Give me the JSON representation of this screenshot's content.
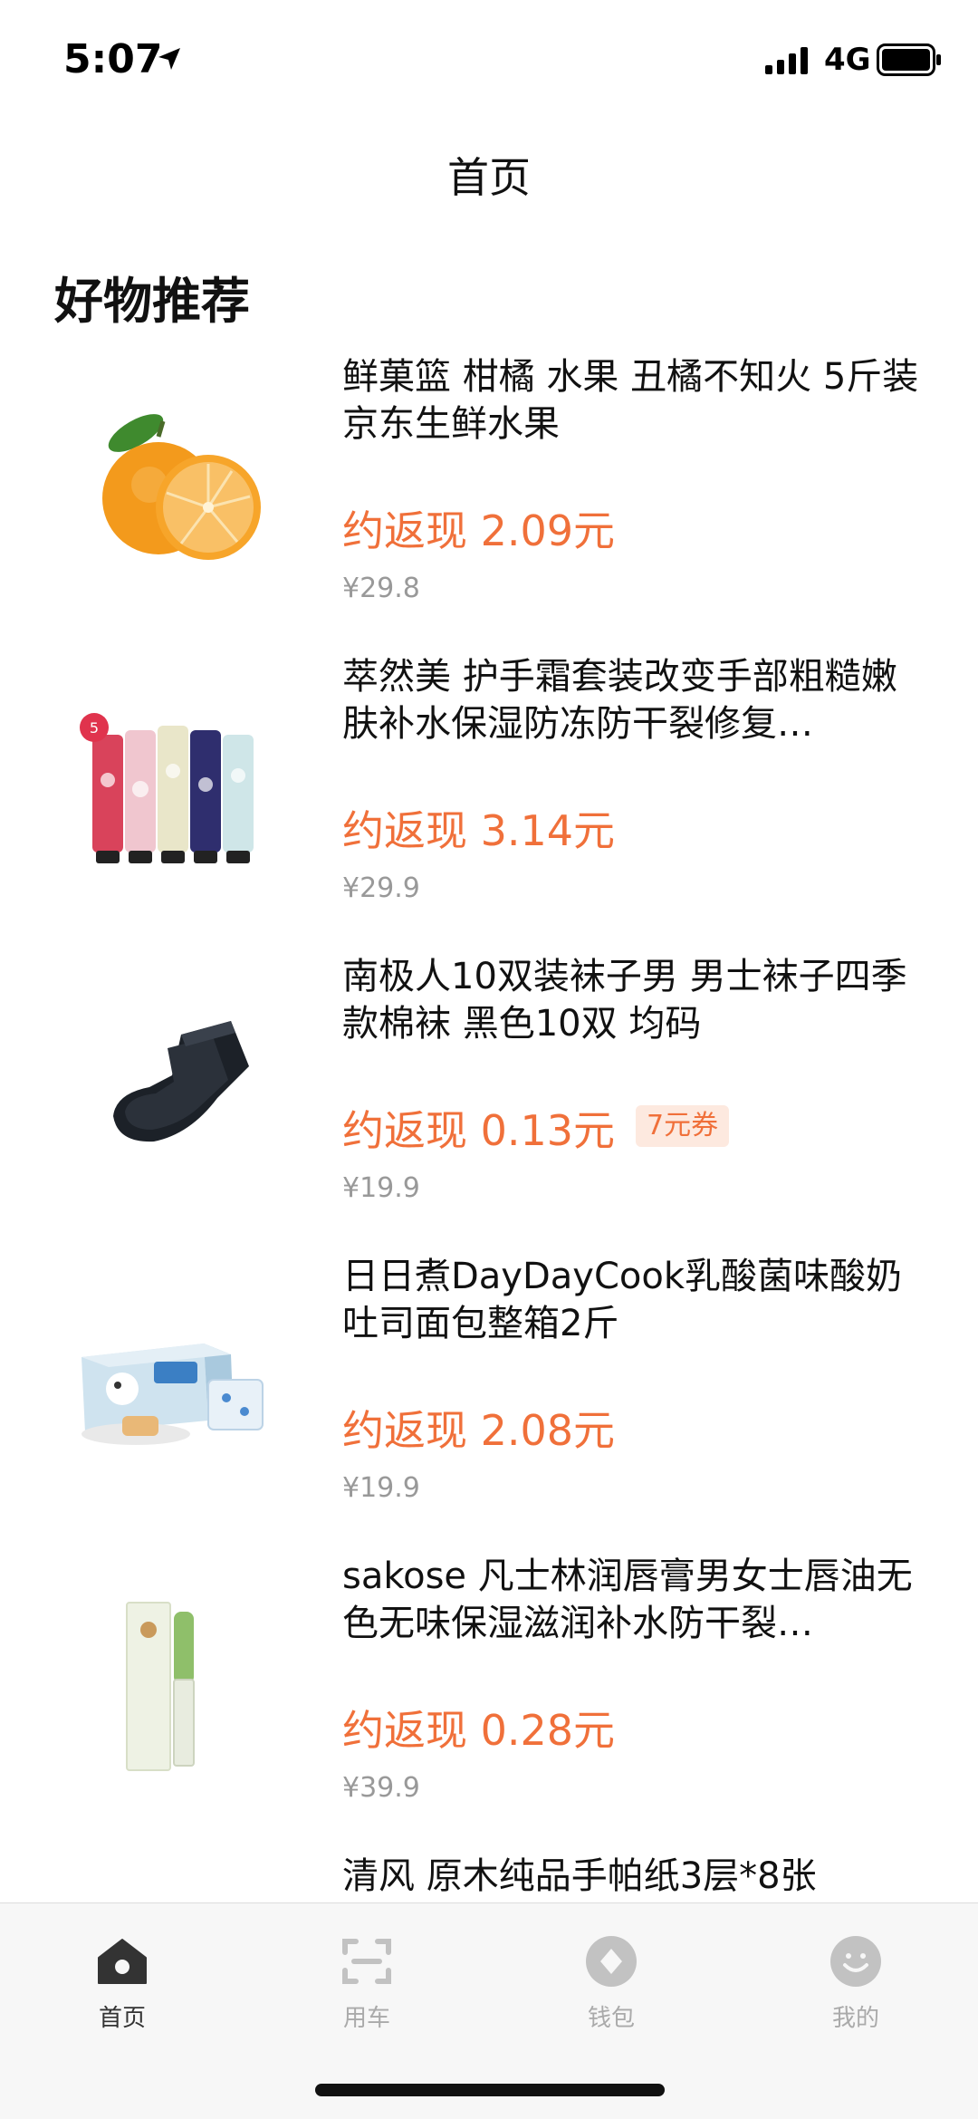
{
  "status": {
    "time": "5:07",
    "network": "4G"
  },
  "nav": {
    "title": "首页"
  },
  "section": {
    "title": "好物推荐"
  },
  "products": [
    {
      "title": "鲜菓篮 柑橘 水果 丑橘不知火 5斤装 京东生鲜水果",
      "cashback": "约返现 2.09元",
      "price": "¥29.8",
      "image": "orange-image"
    },
    {
      "title": "萃然美 护手霜套装改变手部粗糙嫩肤补水保湿防冻防干裂修复…",
      "cashback": "约返现 3.14元",
      "price": "¥29.9",
      "image": "hand-cream-image"
    },
    {
      "title": "南极人10双装袜子男 男士袜子四季款棉袜 黑色10双 均码",
      "cashback": "约返现 0.13元",
      "coupon": "7元券",
      "price": "¥19.9",
      "image": "socks-image"
    },
    {
      "title": "日日煮DayDayCook乳酸菌味酸奶吐司面包整箱2斤",
      "cashback": "约返现 2.08元",
      "price": "¥19.9",
      "image": "bread-box-image"
    },
    {
      "title": "sakose 凡士林润唇膏男女士唇油无色无味保湿滋润补水防干裂…",
      "cashback": "约返现 0.28元",
      "price": "¥39.9",
      "image": "lip-balm-image"
    },
    {
      "title": "清风 原木纯品手帕纸3层*8张",
      "cashback": "",
      "price": "",
      "image": ""
    }
  ],
  "tabs": [
    {
      "label": "首页",
      "icon": "home-icon",
      "active": true
    },
    {
      "label": "用车",
      "icon": "scan-car-icon",
      "active": false
    },
    {
      "label": "钱包",
      "icon": "wallet-icon",
      "active": false
    },
    {
      "label": "我的",
      "icon": "profile-icon",
      "active": false
    }
  ],
  "colors": {
    "accent": "#f0703a",
    "coupon_bg": "#fde9df",
    "muted": "#999999"
  }
}
